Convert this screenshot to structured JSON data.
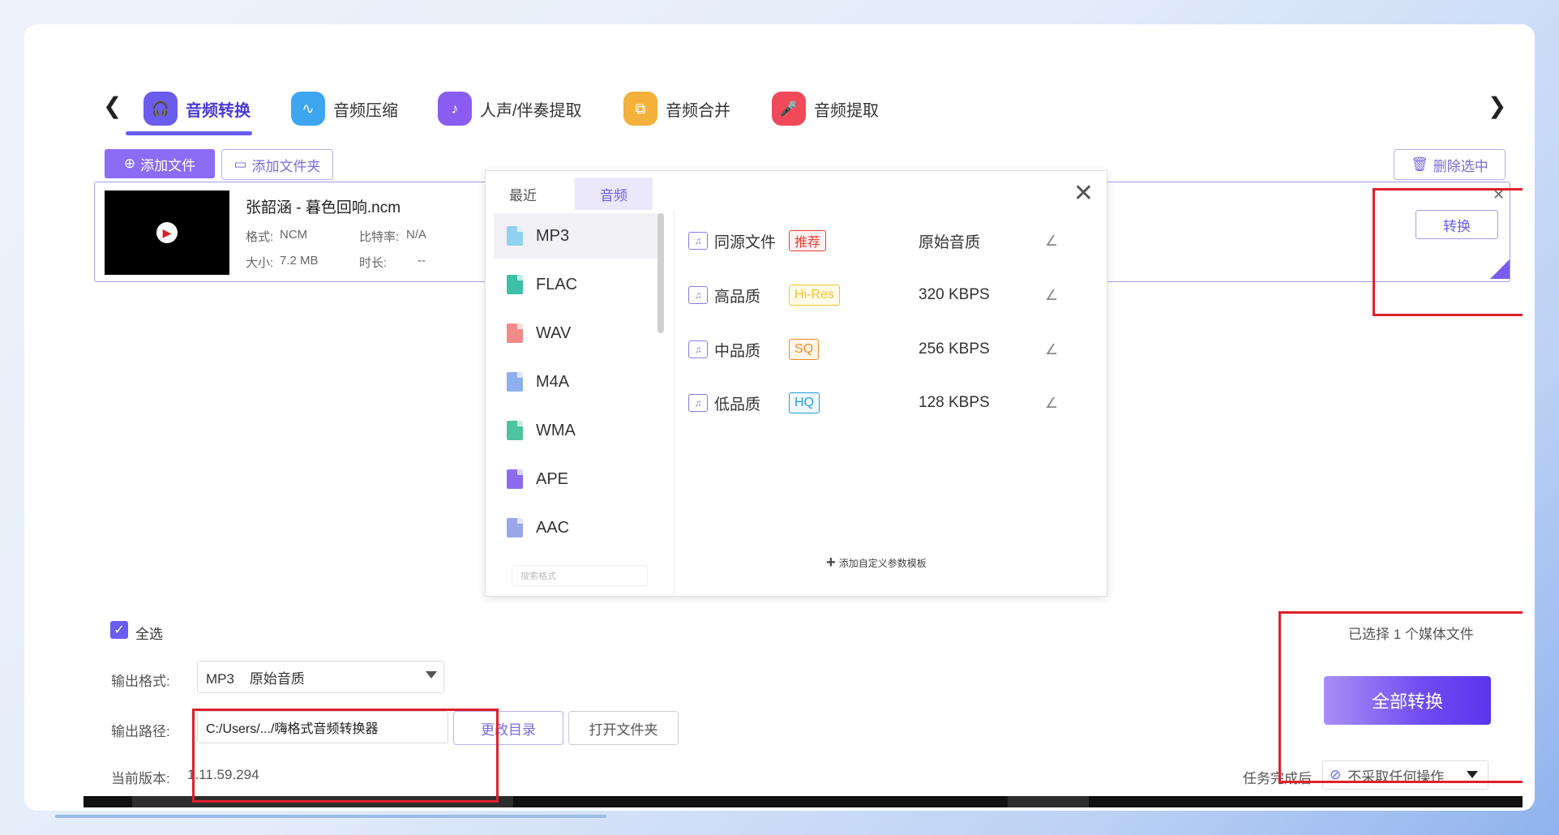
{
  "nav": {
    "tabs": [
      {
        "label": "音频转换",
        "icon": "headphones-icon",
        "color": "#6b5cf0",
        "active": true
      },
      {
        "label": "音频压缩",
        "icon": "waveform-icon",
        "color": "#3da6f0",
        "active": false
      },
      {
        "label": "人声/伴奏提取",
        "icon": "voice-extract-icon",
        "color": "#8b5cf0",
        "active": false
      },
      {
        "label": "音频合并",
        "icon": "merge-icon",
        "color": "#f4b23c",
        "active": false
      },
      {
        "label": "音频提取",
        "icon": "microphone-icon",
        "color": "#f04a5a",
        "active": false
      }
    ]
  },
  "toolbar": {
    "add_file": "添加文件",
    "add_folder": "添加文件夹",
    "delete_selected": "删除选中"
  },
  "file": {
    "name": "张韶涵 - 暮色回响.ncm",
    "format_label": "格式:",
    "format_value": "NCM",
    "bitrate_label": "比特率:",
    "bitrate_value": "N/A",
    "size_label": "大小:",
    "size_value": "7.2 MB",
    "duration_label": "时长:",
    "duration_value": "--",
    "convert_label": "转换"
  },
  "popup": {
    "tabs": [
      "最近",
      "音频"
    ],
    "formats": [
      {
        "label": "MP3",
        "color": "#8fd1ee"
      },
      {
        "label": "FLAC",
        "color": "#3dbfa8"
      },
      {
        "label": "WAV",
        "color": "#f28a8a"
      },
      {
        "label": "M4A",
        "color": "#8fb0ee"
      },
      {
        "label": "WMA",
        "color": "#4ec3a0"
      },
      {
        "label": "APE",
        "color": "#8b6cf0"
      },
      {
        "label": "AAC",
        "color": "#9aa6e8"
      }
    ],
    "search_placeholder": "搜索格式",
    "qualities": [
      {
        "name": "同源文件",
        "badge": "推荐",
        "badge_color": "#e8403a",
        "bitrate": "原始音质"
      },
      {
        "name": "高品质",
        "badge": "Hi-Res",
        "badge_color": "#f1c232",
        "bitrate": "320 KBPS"
      },
      {
        "name": "中品质",
        "badge": "SQ",
        "badge_color": "#f08a2a",
        "bitrate": "256 KBPS"
      },
      {
        "name": "低品质",
        "badge": "HQ",
        "badge_color": "#2a9fd8",
        "bitrate": "128 KBPS"
      }
    ],
    "add_template": "添加自定义参数模板"
  },
  "bottom": {
    "select_all": "全选",
    "output_format_label": "输出格式:",
    "output_format_value": "MP3    原始音质",
    "output_path_label": "输出路径:",
    "output_path_value": "C:/Users/.../嗨格式音频转换器",
    "change_dir": "更改目录",
    "open_folder": "打开文件夹",
    "version_label": "当前版本:",
    "version_value": "1.11.59.294",
    "selected_count": "已选择 1 个媒体文件",
    "convert_all": "全部转换",
    "after_task_label": "任务完成后",
    "after_task_value": "不采取任何操作"
  }
}
